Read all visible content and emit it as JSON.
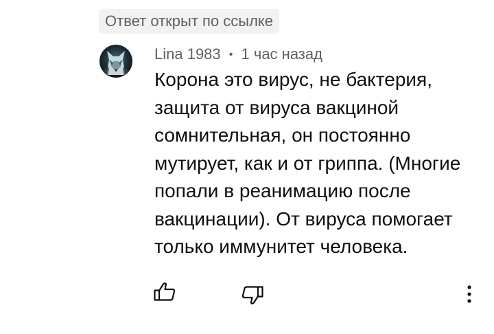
{
  "chip": {
    "label": "Ответ открыт по ссылке"
  },
  "comment": {
    "author": "Lina 1983",
    "separator": "•",
    "time": "1 час назад",
    "text": "Корона это вирус, не бактерия,\nзащита от вируса вакциной\nсомнительная, он постоянно\nмутирует, как и от гриппа. (Многие\nпопали в реанимацию после\nвакцинации). От вируса помогает\nтолько иммунитет человека."
  },
  "icons": {
    "avatar": "wolf-avatar-icon",
    "like": "thumbs-up-icon",
    "dislike": "thumbs-down-icon",
    "menu": "more-vertical-icon"
  },
  "colors": {
    "text": "#0f0f0f",
    "secondary": "#606060",
    "chip_background": "#f2f2f2"
  }
}
